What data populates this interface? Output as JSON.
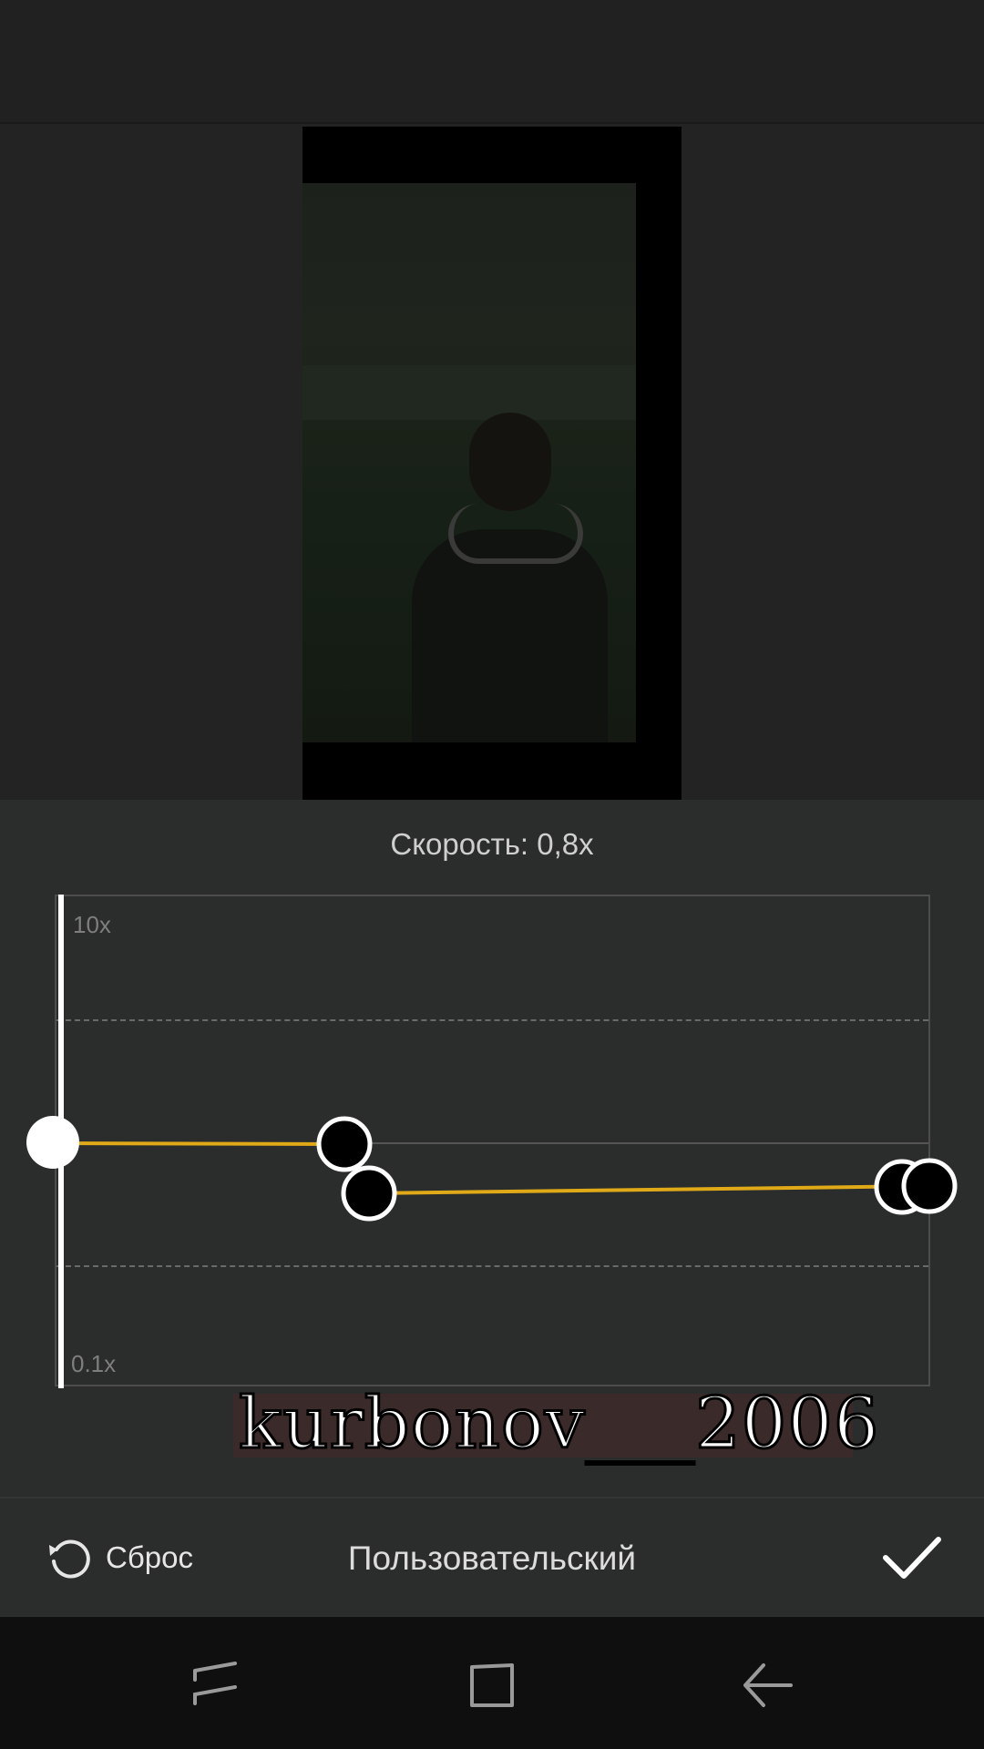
{
  "speed": {
    "label": "Скорость: 0,8x"
  },
  "graph": {
    "max_label": "10x",
    "min_label": "0.1x",
    "curve_color": "#e0a918"
  },
  "watermark": {
    "text": "kurbonov___2006"
  },
  "toolbar": {
    "reset_label": "Сброс",
    "mode_label": "Пользовательский"
  },
  "icons": {
    "reset": "reset-icon",
    "confirm": "checkmark-icon",
    "recents": "recents-icon",
    "home": "home-icon",
    "back": "back-icon"
  }
}
